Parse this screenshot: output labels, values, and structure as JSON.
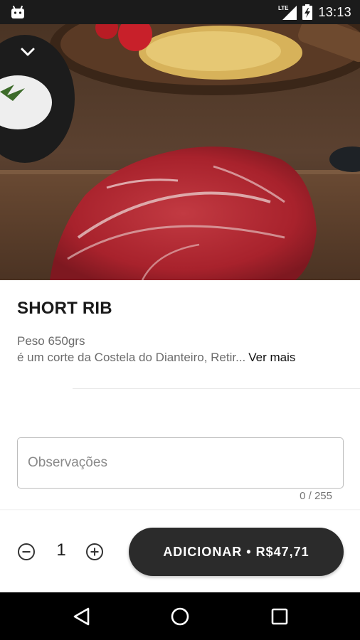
{
  "status_bar": {
    "time": "13:13",
    "network_label": "LTE",
    "icons": [
      "android-debug-icon",
      "lte-signal-icon",
      "battery-charging-icon"
    ]
  },
  "hero": {
    "image_description_icon": "meat-photo",
    "back_icon": "chevron-down-icon"
  },
  "product": {
    "title": "SHORT RIB",
    "weight": "Peso 650grs",
    "description": "é um corte da Costela do Dianteiro, Retir...",
    "more_label": "Ver mais"
  },
  "observations": {
    "placeholder": "Observações",
    "value": "",
    "counter": "0 / 255"
  },
  "cart": {
    "quantity": "1",
    "minus_icon": "minus-circle-icon",
    "plus_icon": "plus-circle-icon",
    "add_label": "ADICIONAR • R$47,71"
  },
  "nav": {
    "icons": [
      "back-triangle-icon",
      "home-circle-icon",
      "recents-square-icon"
    ]
  },
  "colors": {
    "status_bar": "#1b1b1b",
    "button_bg": "#2b2b2b",
    "nav_bar": "#000000",
    "meat": "#b3262f"
  }
}
